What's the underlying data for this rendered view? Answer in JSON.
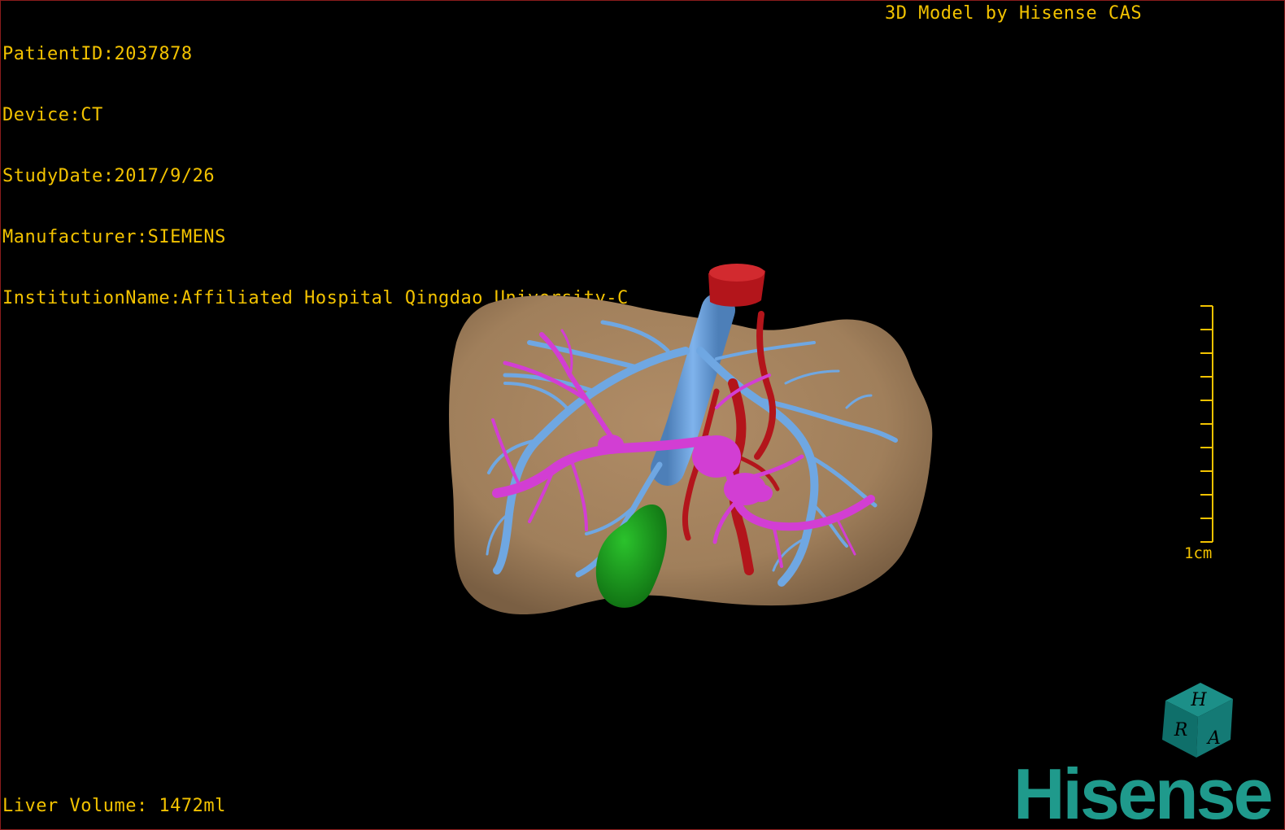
{
  "overlay": {
    "patient_id": "PatientID:2037878",
    "device": "Device:CT",
    "study_date": "StudyDate:2017/9/26",
    "manufacturer": "Manufacturer:SIEMENS",
    "institution": "InstitutionName:Affiliated Hospital Qingdao University-C",
    "model_credit": "3D Model by Hisense CAS",
    "liver_volume": "Liver Volume: 1472ml"
  },
  "scale_bar": {
    "label": "1cm"
  },
  "orientation_cube": {
    "face_labels": [
      "H",
      "R",
      "A"
    ],
    "color": "#147a75"
  },
  "brand": {
    "name": "Hisense",
    "color": "#1f9a8c"
  },
  "colors": {
    "overlay_text": "#f2c200",
    "liver": "#a07f5b",
    "hepatic_vein": "#6fa7e2",
    "portal_vein": "#d23ed3",
    "artery_ivc": "#b3151b",
    "gallbladder": "#1d9a1f",
    "border": "#8a1c1c"
  },
  "model": {
    "structures": [
      "liver",
      "hepatic-vein",
      "portal-vein",
      "artery",
      "gallbladder"
    ]
  }
}
